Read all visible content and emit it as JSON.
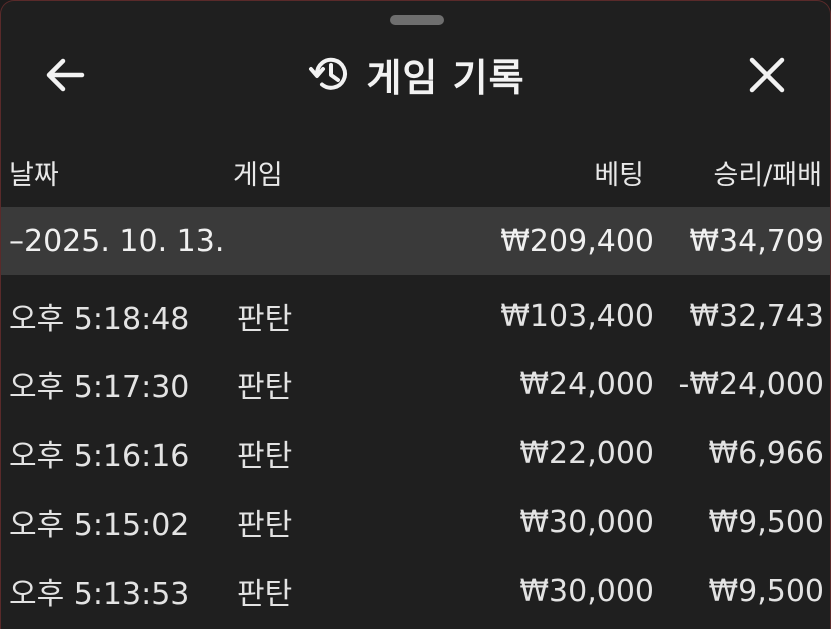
{
  "header": {
    "title": "게임 기록",
    "back_icon": "arrow-left-icon",
    "history_icon": "history-icon",
    "close_icon": "close-icon"
  },
  "columns": {
    "date": "날짜",
    "game": "게임",
    "bet": "베팅",
    "result": "승리/패배"
  },
  "group": {
    "date": "–2025. 10. 13.",
    "bet": "₩209,400",
    "result": "₩34,709"
  },
  "rows": [
    {
      "time": "오후 5:18:48",
      "game": "판탄",
      "bet": "₩103,400",
      "result": "₩32,743"
    },
    {
      "time": "오후 5:17:30",
      "game": "판탄",
      "bet": "₩24,000",
      "result": "-₩24,000"
    },
    {
      "time": "오후 5:16:16",
      "game": "판탄",
      "bet": "₩22,000",
      "result": "₩6,966"
    },
    {
      "time": "오후 5:15:02",
      "game": "판탄",
      "bet": "₩30,000",
      "result": "₩9,500"
    },
    {
      "time": "오후 5:13:53",
      "game": "판탄",
      "bet": "₩30,000",
      "result": "₩9,500"
    }
  ],
  "colors": {
    "background": "#1f1f1f",
    "group_row": "#3a3a3a",
    "text": "#e3e3e3"
  }
}
